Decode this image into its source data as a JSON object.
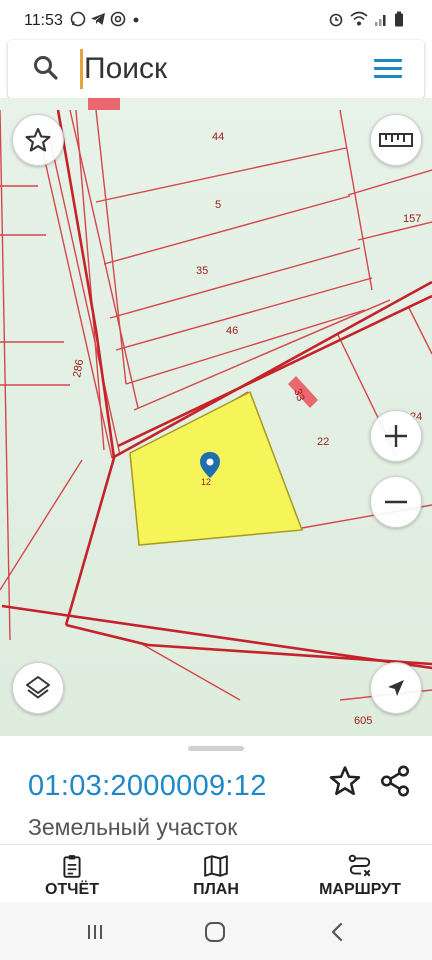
{
  "status_bar": {
    "time": "11:53",
    "left_icons": [
      "whatsapp-icon",
      "telegram-icon",
      "at-icon",
      "dot-icon"
    ],
    "right_icons": [
      "alarm-icon",
      "wifi-icon",
      "signal-icon",
      "battery-icon"
    ]
  },
  "search": {
    "placeholder": "Поиск"
  },
  "map": {
    "parcel_labels": [
      "44",
      "5",
      "157",
      "35",
      "46",
      "286",
      "33",
      "22",
      "24",
      "12",
      "605"
    ],
    "selected_parcel_color": "#f5f55a",
    "boundary_color": "#c8252b",
    "background_color": "#e8f3ea"
  },
  "parcel": {
    "number": "01:03:2000009:12",
    "type": "Земельный участок"
  },
  "actions": {
    "report": "ОТЧЁТ",
    "plan": "ПЛАН",
    "route": "МАРШРУТ"
  },
  "colors": {
    "accent": "#1e88c7",
    "cursor": "#e8a33a"
  }
}
